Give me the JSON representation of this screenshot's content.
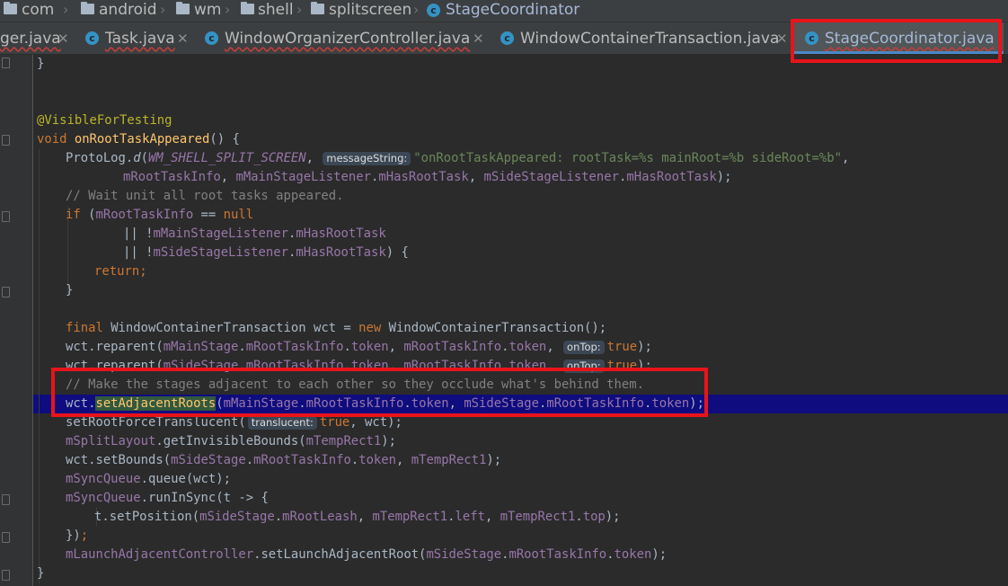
{
  "breadcrumb": [
    "com",
    "android",
    "wm",
    "shell",
    "splitscreen",
    "StageCoordinator"
  ],
  "tabs": [
    {
      "label": "ger.java",
      "active": false
    },
    {
      "label": "Task.java",
      "active": false
    },
    {
      "label": "WindowOrganizerController.java",
      "active": false
    },
    {
      "label": "WindowContainerTransaction.java",
      "active": false
    },
    {
      "label": "StageCoordinator.java",
      "active": true
    }
  ],
  "code": {
    "l01": "}",
    "l04": "@VisibleForTesting",
    "l05_kw": "void ",
    "l05_fn": "onRootTaskAppeared",
    "l05_rest": "() {",
    "l06_a": "ProtoLog.",
    "l06_b": "d",
    "l06_c": "(",
    "l06_d": "WM_SHELL_SPLIT_SCREEN",
    "l06_e": ", ",
    "l06_hint": "messageString:",
    "l06_f": "\"onRootTaskAppeared: rootTask=%s mainRoot=%b sideRoot=%b\"",
    "l06_g": ",",
    "l07_a": "mRootTaskInfo",
    "l07_b": ", ",
    "l07_c": "mMainStageListener",
    "l07_d": ".",
    "l07_e": "mHasRootTask",
    "l07_f": ", ",
    "l07_g": "mSideStageListener",
    "l07_h": ".",
    "l07_i": "mHasRootTask",
    "l07_j": ");",
    "l08": "// Wait unit all root tasks appeared.",
    "l09_a": "if ",
    "l09_b": "(",
    "l09_c": "mRootTaskInfo",
    "l09_d": " == ",
    "l09_e": "null",
    "l10_a": "|| !",
    "l10_b": "mMainStageListener",
    "l10_c": ".",
    "l10_d": "mHasRootTask",
    "l11_a": "|| !",
    "l11_b": "mSideStageListener",
    "l11_c": ".",
    "l11_d": "mHasRootTask",
    "l11_e": ") {",
    "l12_a": "return",
    "l12_b": ";",
    "l13": "}",
    "l15_a": "final ",
    "l15_b": "WindowContainerTransaction wct = ",
    "l15_c": "new ",
    "l15_d": "WindowContainerTransaction();",
    "l16_a": "wct.reparent(",
    "l16_b": "mMainStage",
    "l16_c": ".",
    "l16_d": "mRootTaskInfo",
    "l16_e": ".",
    "l16_f": "token",
    "l16_g": ", ",
    "l16_h": "mRootTaskInfo",
    "l16_i": ".",
    "l16_j": "token",
    "l16_k": ", ",
    "l16_hint": "onTop:",
    "l16_l": "true",
    "l16_m": ");",
    "l17_a": "wct.reparent(",
    "l17_b": "mSideStage",
    "l17_c": ".",
    "l17_d": "mRootTaskInfo",
    "l17_e": ".",
    "l17_f": "token",
    "l17_g": ", ",
    "l17_h": "mRootTaskInfo",
    "l17_i": ".",
    "l17_j": "token",
    "l17_k": ", ",
    "l17_hint": "onTop:",
    "l17_l": "true",
    "l17_m": ");",
    "l18": "// Make the stages adjacent to each other so they occlude what's behind them.",
    "l19_a": "wct.",
    "l19_b": "setAdjacentRoots",
    "l19_c": "(",
    "l19_d": "mMainStage",
    "l19_e": ".",
    "l19_f": "mRootTaskInfo",
    "l19_g": ".",
    "l19_h": "token",
    "l19_i": ", ",
    "l19_j": "mSideStage",
    "l19_k": ".",
    "l19_l": "mRootTaskInfo",
    "l19_m": ".",
    "l19_n": "token",
    "l19_o": ");",
    "l20_a": "setRootForceTranslucent(",
    "l20_hint": "translucent:",
    "l20_b": "true",
    "l20_c": ", wct);",
    "l21_a": "mSplitLayout",
    "l21_b": ".getInvisibleBounds(",
    "l21_c": "mTempRect1",
    "l21_d": ");",
    "l22_a": "wct.setBounds(",
    "l22_b": "mSideStage",
    "l22_c": ".",
    "l22_d": "mRootTaskInfo",
    "l22_e": ".",
    "l22_f": "token",
    "l22_g": ", ",
    "l22_h": "mTempRect1",
    "l22_i": ");",
    "l23_a": "mSyncQueue",
    "l23_b": ".queue(wct);",
    "l24_a": "mSyncQueue",
    "l24_b": ".runInSync(t -> {",
    "l25_a": "t.setPosition(",
    "l25_b": "mSideStage",
    "l25_c": ".",
    "l25_d": "mRootLeash",
    "l25_e": ", ",
    "l25_f": "mTempRect1",
    "l25_g": ".",
    "l25_h": "left",
    "l25_i": ", ",
    "l25_j": "mTempRect1",
    "l25_k": ".",
    "l25_l": "top",
    "l25_m": ");",
    "l26_a": "})",
    "l26_b": ";",
    "l27_a": "mLaunchAdjacentController",
    "l27_b": ".setLaunchAdjacentRoot(",
    "l27_c": "mSideStage",
    "l27_d": ".",
    "l27_e": "mRootTaskInfo",
    "l27_f": ".",
    "l27_g": "token",
    "l27_h": ");",
    "l28": "}"
  },
  "colors": {
    "keyword": "#cc7832",
    "function": "#ffc66d",
    "field": "#9876aa",
    "string": "#6a8759",
    "comment": "#808080",
    "annotation": "#bbb529",
    "highlight_line": "#0e0c7e",
    "annotation_box": "#e8141a"
  },
  "icons": [
    "folder-icon",
    "class-icon",
    "close-icon",
    "fold-marker-icon"
  ]
}
